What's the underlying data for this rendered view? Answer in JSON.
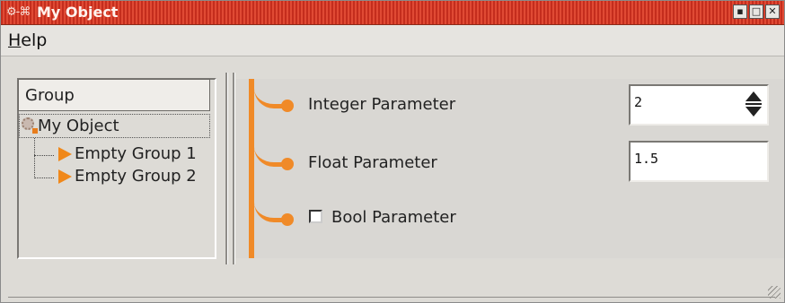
{
  "window": {
    "title": "My Object",
    "sys_icons": "⚙-⌘",
    "controls": {
      "minimize": "▪",
      "maximize": "□",
      "close": "✕"
    }
  },
  "menubar": {
    "help_prefix": "H",
    "help_rest": "elp"
  },
  "tree": {
    "header": "Group",
    "root": {
      "label": "My Object",
      "icon": "gear-icon"
    },
    "children": [
      {
        "label": "Empty Group 1",
        "icon": "orange-arrow-icon"
      },
      {
        "label": "Empty Group 2",
        "icon": "orange-arrow-icon"
      }
    ]
  },
  "params": {
    "integer": {
      "label": "Integer Parameter",
      "value": "2"
    },
    "float": {
      "label": "Float Parameter",
      "value": "1.5"
    },
    "bool": {
      "label": "Bool Parameter",
      "checked": false
    }
  },
  "colors": {
    "titlebar": "#cf3a27",
    "accent_orange": "#f08a28",
    "background": "#dddbd6"
  }
}
